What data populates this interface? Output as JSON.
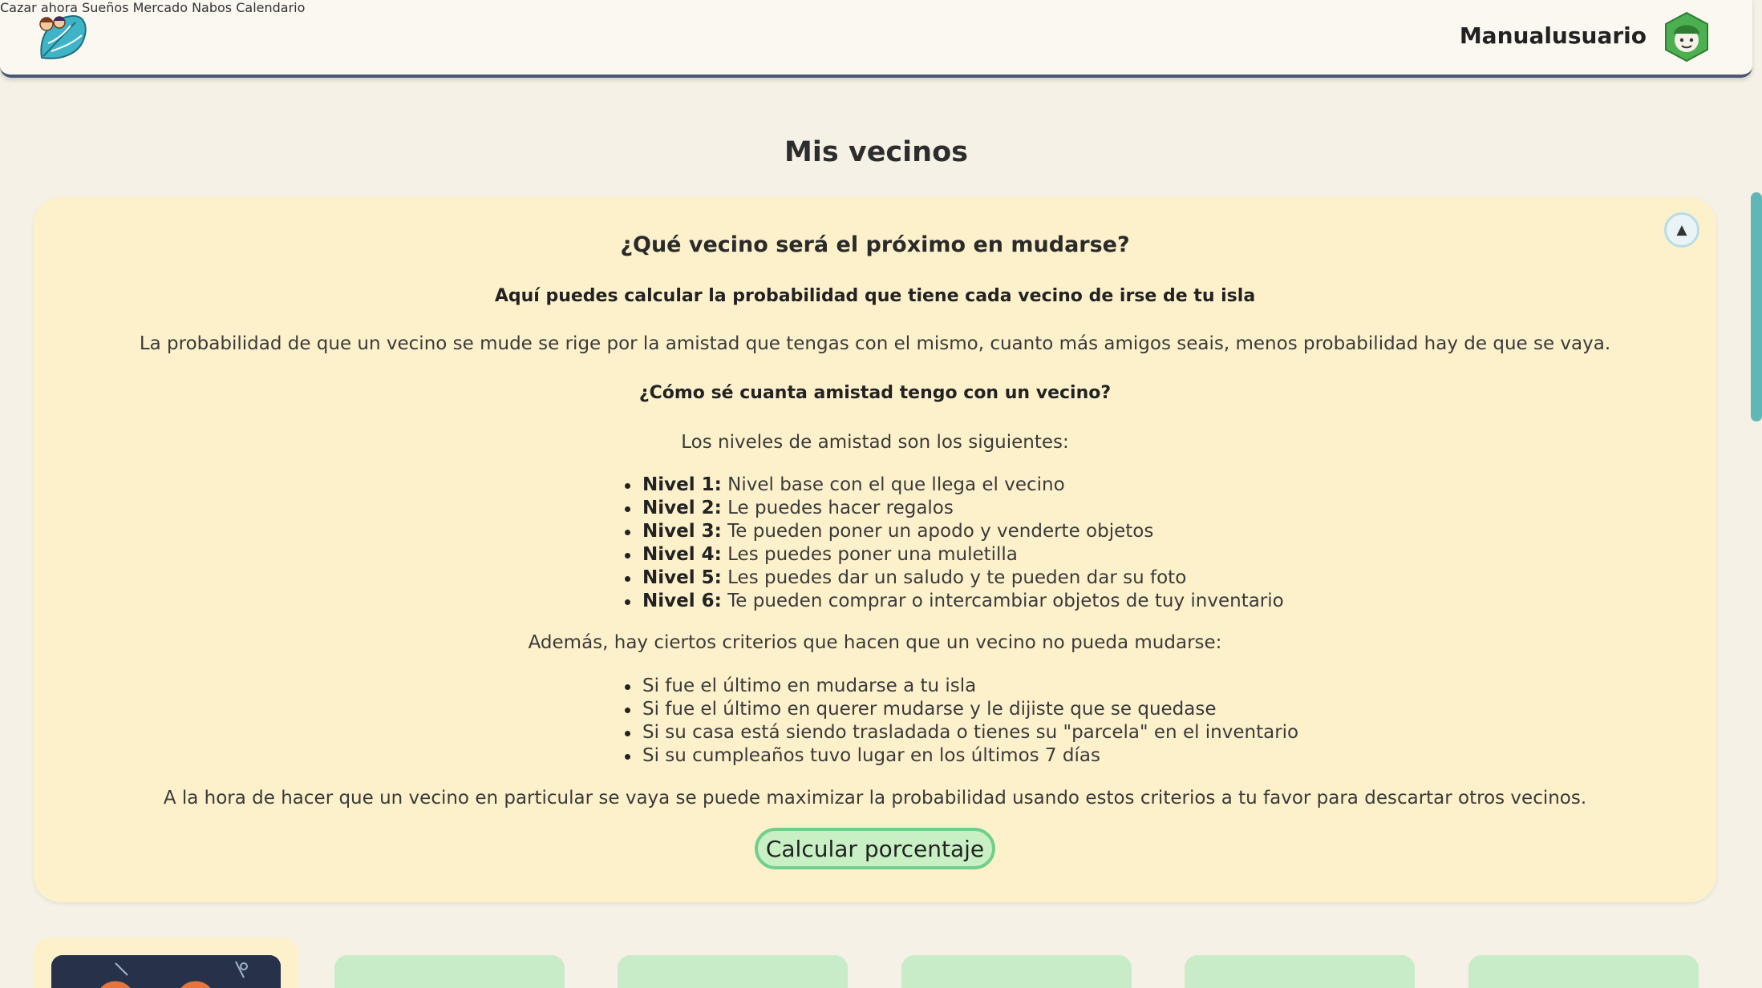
{
  "header": {
    "logo_icon": "leaf-logo-icon",
    "nav": [
      {
        "label": "Cazar ahora"
      },
      {
        "label": "Sueños"
      },
      {
        "label": "Mercado Nabos"
      },
      {
        "label": "Calendario"
      }
    ],
    "username": "Manualusuario",
    "avatar_icon": "villager-avatar-icon"
  },
  "page": {
    "title": "Mis vecinos"
  },
  "info": {
    "question": "¿Qué vecino será el próximo en mudarse?",
    "subtitle": "Aquí puedes calcular la probabilidad que tiene cada vecino de irse de tu isla",
    "intro": "La probabilidad de que un vecino se mude se rige por la amistad que tengas con el mismo, cuanto más amigos seais, menos probabilidad hay de que se vaya.",
    "friendship_question": "¿Cómo sé cuanta amistad tengo con un vecino?",
    "levels_intro": "Los niveles de amistad son los siguientes:",
    "levels": [
      {
        "name": "Nivel 1:",
        "text": "Nivel base con el que llega el vecino"
      },
      {
        "name": "Nivel 2:",
        "text": "Le puedes hacer regalos"
      },
      {
        "name": "Nivel 3:",
        "text": "Te pueden poner un apodo y venderte objetos"
      },
      {
        "name": "Nivel 4:",
        "text": "Les puedes poner una muletilla"
      },
      {
        "name": "Nivel 5:",
        "text": "Les puedes dar un saludo y te pueden dar su foto"
      },
      {
        "name": "Nivel 6:",
        "text": "Te pueden comprar o intercambiar objetos de tuy inventario"
      }
    ],
    "criteria_intro": "Además, hay ciertos criterios que hacen que un vecino no pueda mudarse:",
    "criteria": [
      "Si fue el último en mudarse a tu isla",
      "Si fue el último en querer mudarse y le dijiste que se quedase",
      "Si su casa está siendo trasladada o tienes su \"parcela\" en el inventario",
      "Si su cumpleaños tuvo lugar en los últimos 7 días"
    ],
    "closing": "A la hora de hacer que un vecino en particular se vaya se puede maximizar la probabilidad usando estos criterios a tu favor para descartar otros vecinos.",
    "calc_button": "Calcular porcentaje",
    "collapse_icon": "▲"
  },
  "colors": {
    "background": "#f6f1e6",
    "panel": "#fdf1cb",
    "button_fill": "#c9f0c4",
    "button_border": "#72cf8b",
    "card": "#c9ecc8",
    "header_border": "#4b5677",
    "scrollbar": "#5fb8b7"
  }
}
